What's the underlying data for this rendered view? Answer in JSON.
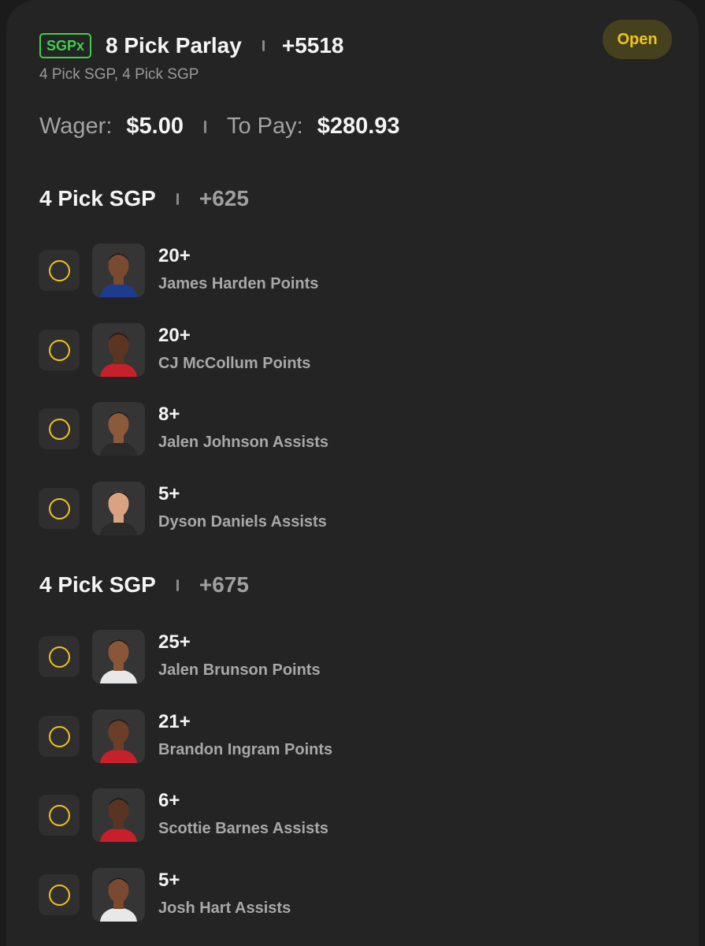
{
  "bet": {
    "badge": "SGPx",
    "title": "8 Pick Parlay",
    "odds": "+5518",
    "subtitle": "4 Pick SGP, 4 Pick SGP",
    "status": "Open",
    "wager_label": "Wager:",
    "wager_value": "$5.00",
    "topay_label": "To Pay:",
    "topay_value": "$280.93"
  },
  "sections": [
    {
      "title": "4 Pick SGP",
      "odds": "+625",
      "picks": [
        {
          "line": "20+",
          "desc": "James Harden Points",
          "jersey": "#1d3c8f",
          "skin": "#7a4a30"
        },
        {
          "line": "20+",
          "desc": "CJ McCollum Points",
          "jersey": "#c8202b",
          "skin": "#5b3522"
        },
        {
          "line": "8+",
          "desc": "Jalen Johnson Assists",
          "jersey": "#2a2a2a",
          "skin": "#8a5a3a"
        },
        {
          "line": "5+",
          "desc": "Dyson Daniels Assists",
          "jersey": "#2a2a2a",
          "skin": "#d9a382"
        }
      ]
    },
    {
      "title": "4 Pick SGP",
      "odds": "+675",
      "picks": [
        {
          "line": "25+",
          "desc": "Jalen Brunson Points",
          "jersey": "#e8e8e8",
          "skin": "#8a5638"
        },
        {
          "line": "21+",
          "desc": "Brandon Ingram Points",
          "jersey": "#c8202b",
          "skin": "#6a3e28"
        },
        {
          "line": "6+",
          "desc": "Scottie Barnes Assists",
          "jersey": "#c8202b",
          "skin": "#5a3423"
        },
        {
          "line": "5+",
          "desc": "Josh Hart Assists",
          "jersey": "#e8e8e8",
          "skin": "#7a4a30"
        }
      ]
    }
  ]
}
